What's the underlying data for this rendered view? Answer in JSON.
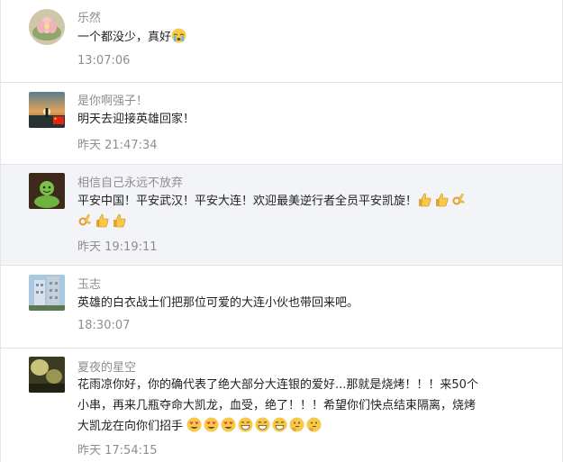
{
  "comments": [
    {
      "name": "乐然",
      "text": "一个都没少，真好",
      "time": "13:07:06",
      "emojis": [
        "crying-face-emoji"
      ]
    },
    {
      "name": "是你啊强子！",
      "text": "明天去迎接英雄回家！",
      "time": "昨天 21:47:34",
      "badge": "china-flag-icon"
    },
    {
      "name": "相信自己永远不放弃",
      "text": "平安中国！平安武汉！平安大连！欢迎最美逆行者全员平安凯旋！",
      "time": "昨天 19:19:11",
      "emojis": [
        "thumbs-up-emoji",
        "thumbs-up-emoji",
        "ok-hand-emoji",
        "ok-hand-emoji",
        "thumbs-up-emoji",
        "thumbs-up-emoji"
      ]
    },
    {
      "name": "玉志",
      "text": "英雄的白衣战士们把那位可爱的大连小伙也带回来吧。",
      "time": "18:30:07"
    },
    {
      "name": "夏夜的星空",
      "text_line1": "花雨凉你好，你的确代表了绝大部分大连银的爱好...那就是烧烤！！！来50个",
      "text_line2": "小串，再来几瓶夺命大凯龙，血受，绝了！！！希望你们快点结束隔离，烧烤",
      "text_line3": "大凯龙在向你们招手",
      "time": "昨天 17:54:15",
      "emojis": [
        "heart-eyes-emoji",
        "heart-eyes-emoji",
        "heart-eyes-emoji",
        "grin-emoji",
        "grin-emoji",
        "grin-emoji",
        "thinking-emoji",
        "thinking-emoji"
      ]
    }
  ],
  "colors": {
    "name": "#8e8e8e",
    "text": "#222222",
    "time": "#8e8e8e",
    "highlight_bg": "#f3f4f7",
    "divider": "#e3e3e3"
  }
}
